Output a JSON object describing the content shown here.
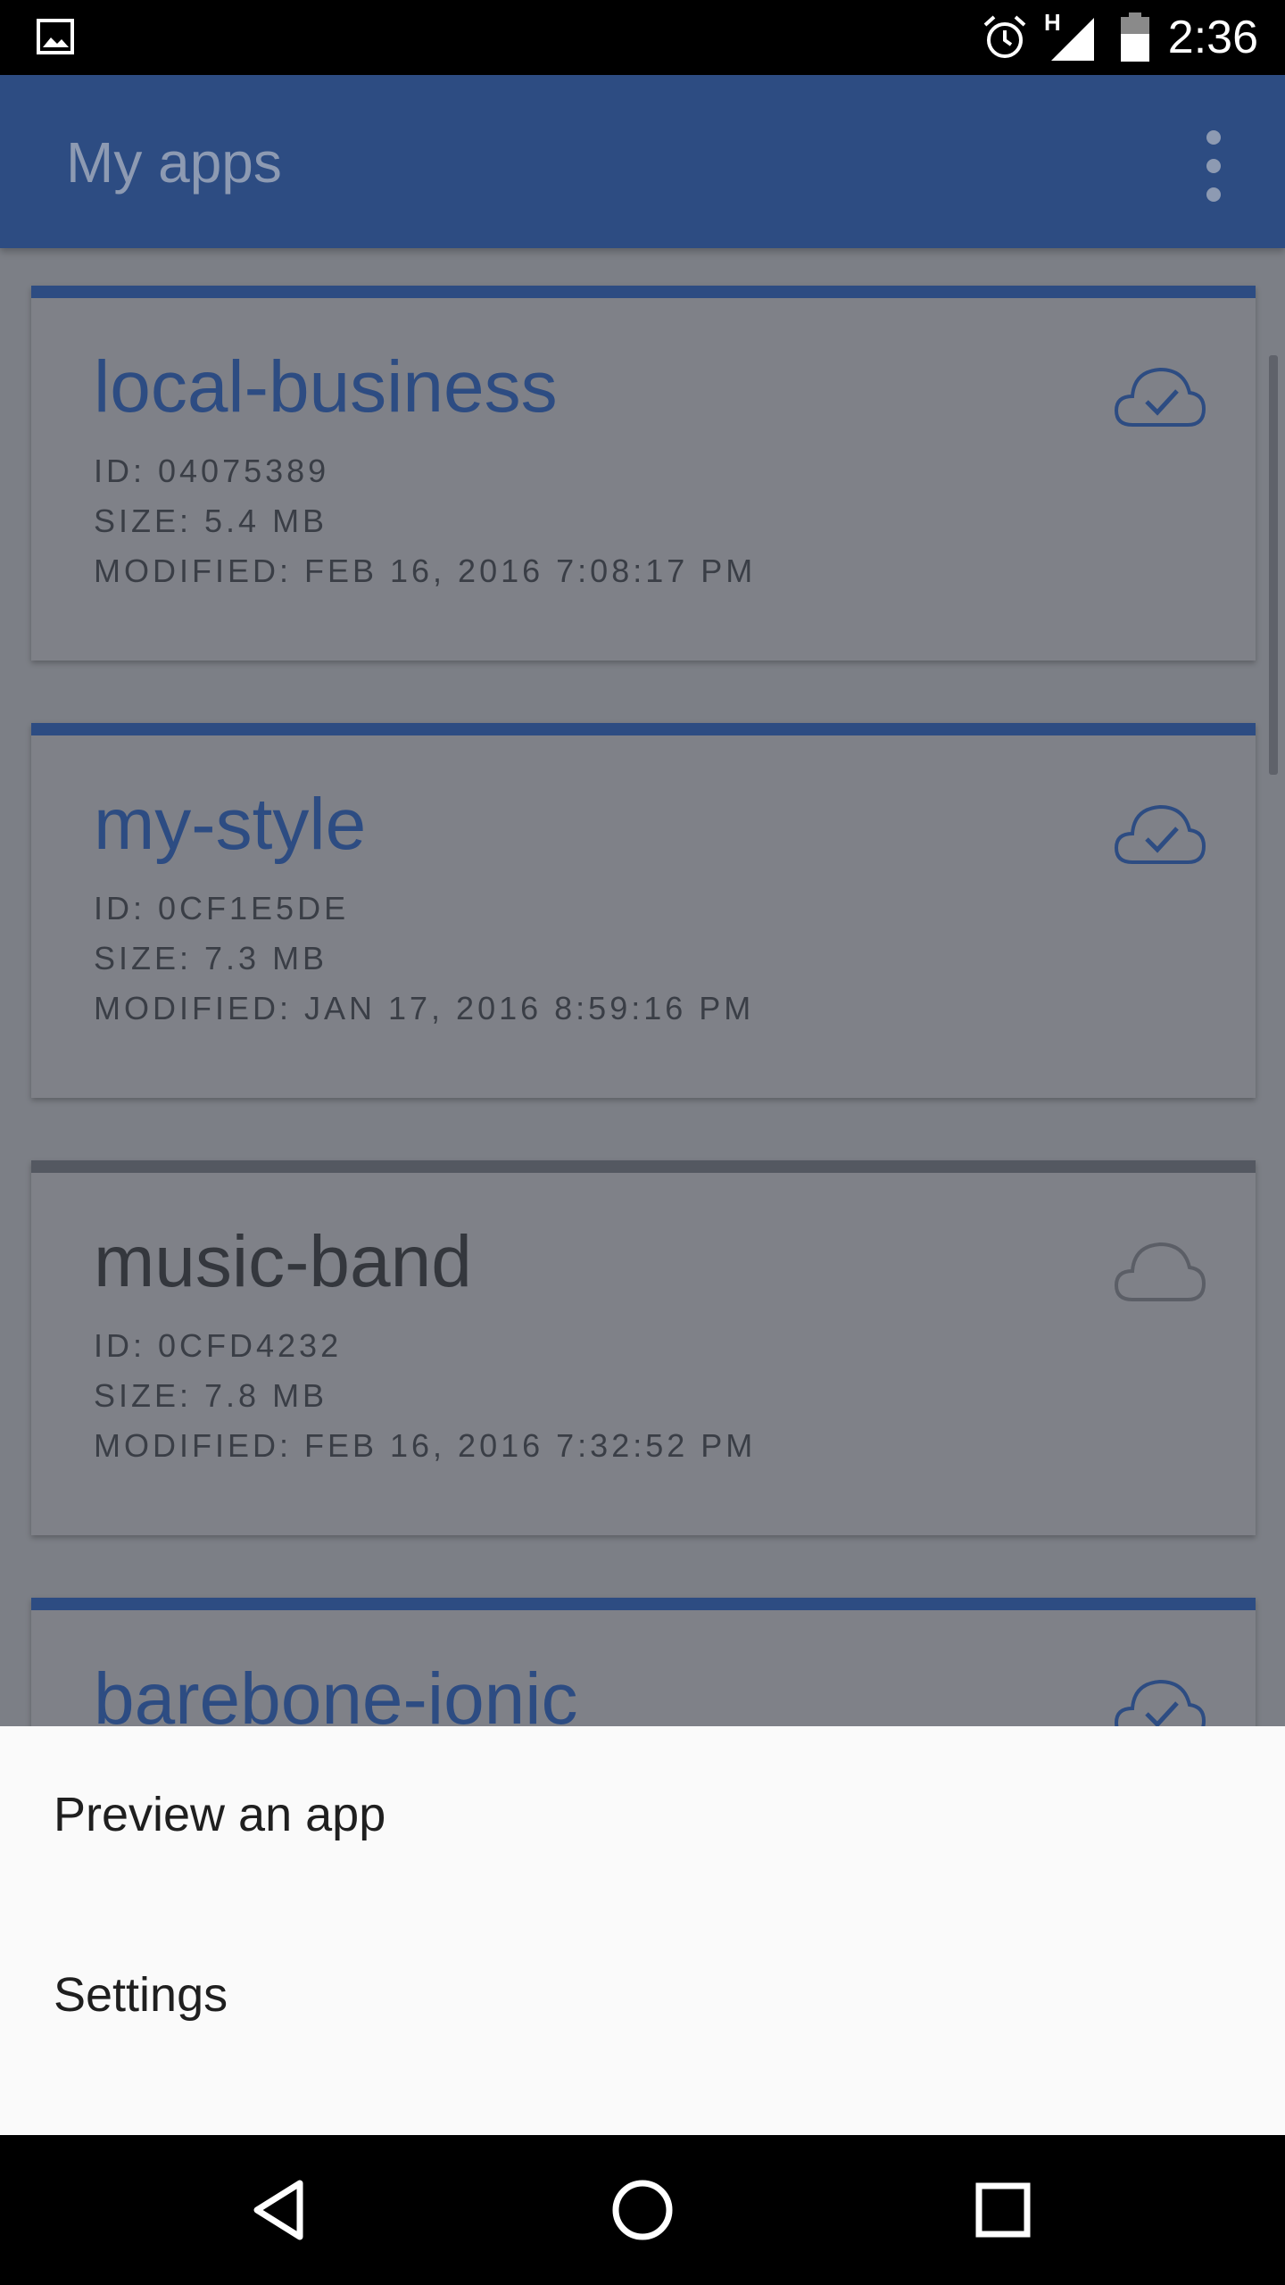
{
  "status_bar": {
    "time": "2:36",
    "network_label": "H",
    "icons": [
      "gallery-icon",
      "alarm-icon",
      "signal-icon",
      "battery-icon"
    ]
  },
  "app_bar": {
    "title": "My apps",
    "overflow_icon": "more-vert-icon"
  },
  "apps": [
    {
      "name": "local-business",
      "id": "ID: 04075389",
      "size": "SIZE: 5.4 MB",
      "modified": "MODIFIED: FEB 16, 2016 7:08:17 PM",
      "synced": true
    },
    {
      "name": "my-style",
      "id": "ID: 0CF1E5DE",
      "size": "SIZE: 7.3 MB",
      "modified": "MODIFIED: JAN 17, 2016 8:59:16 PM",
      "synced": true
    },
    {
      "name": "music-band",
      "id": "ID: 0CFD4232",
      "size": "SIZE: 7.8 MB",
      "modified": "MODIFIED: FEB 16, 2016 7:32:52 PM",
      "synced": false
    },
    {
      "name": "barebone-ionic",
      "synced": true
    }
  ],
  "bottom_sheet": {
    "items": [
      {
        "label": "Preview an app"
      },
      {
        "label": "Settings"
      }
    ]
  },
  "nav_bar": {
    "icons": [
      "back-icon",
      "home-icon",
      "recents-icon"
    ]
  },
  "colors": {
    "primary": "#2d4c82",
    "offline": "#545861",
    "scrim_card": "#7f8188",
    "sheet": "#fafafa"
  }
}
